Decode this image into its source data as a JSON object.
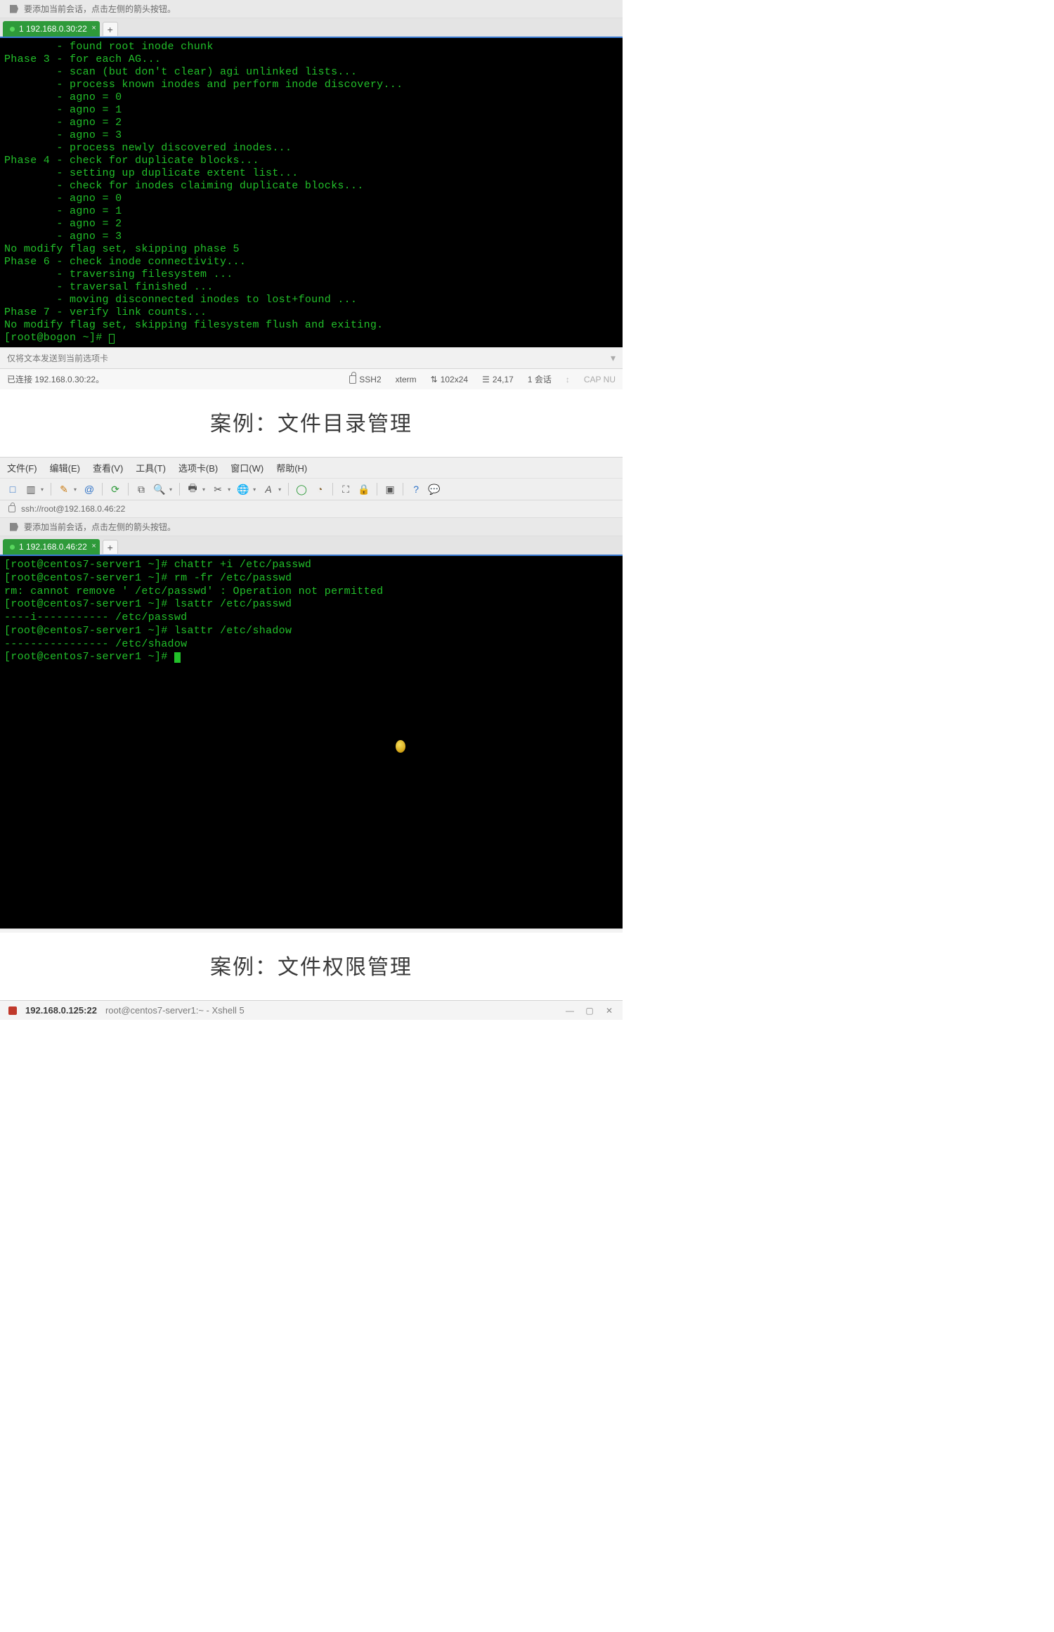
{
  "hint1": "要添加当前会话，点击左侧的箭头按钮。",
  "tab1": {
    "label": "1 192.168.0.30:22"
  },
  "addtab": "+",
  "term1_lines": [
    "        - found root inode chunk",
    "Phase 3 - for each AG...",
    "        - scan (but don't clear) agi unlinked lists...",
    "        - process known inodes and perform inode discovery...",
    "        - agno = 0",
    "        - agno = 1",
    "        - agno = 2",
    "        - agno = 3",
    "        - process newly discovered inodes...",
    "Phase 4 - check for duplicate blocks...",
    "        - setting up duplicate extent list...",
    "        - check for inodes claiming duplicate blocks...",
    "        - agno = 0",
    "        - agno = 1",
    "        - agno = 2",
    "        - agno = 3",
    "No modify flag set, skipping phase 5",
    "Phase 6 - check inode connectivity...",
    "        - traversing filesystem ...",
    "        - traversal finished ...",
    "        - moving disconnected inodes to lost+found ...",
    "Phase 7 - verify link counts...",
    "No modify flag set, skipping filesystem flush and exiting."
  ],
  "term1_prompt": "[root@bogon ~]# ",
  "sendbar_text": "仅将文本发送到当前选项卡",
  "status1": {
    "left": "已连接 192.168.0.30:22。",
    "ssh": "SSH2",
    "term": "xterm",
    "size": "102x24",
    "pos": "24,17",
    "sess": "1 会话",
    "caps": "CAP  NU"
  },
  "heading1": "案例：文件目录管理",
  "menubar": {
    "file": "文件(F)",
    "edit": "编辑(E)",
    "view": "查看(V)",
    "tools": "工具(T)",
    "tabs": "选项卡(B)",
    "window": "窗口(W)",
    "help": "帮助(H)"
  },
  "addrbar": "ssh://root@192.168.0.46:22",
  "hint2": "要添加当前会话，点击左侧的箭头按钮。",
  "tab2": {
    "label": "1 192.168.0.46:22"
  },
  "term2_lines": [
    "[root@centos7-server1 ~]# chattr +i /etc/passwd",
    "[root@centos7-server1 ~]# rm -fr /etc/passwd",
    "rm: cannot remove ' /etc/passwd' : Operation not permitted",
    "[root@centos7-server1 ~]# lsattr /etc/passwd",
    "----i----------- /etc/passwd",
    "[root@centos7-server1 ~]# lsattr /etc/shadow",
    "---------------- /etc/shadow",
    "[root@centos7-server1 ~]# "
  ],
  "heading2": "案例：文件权限管理",
  "title3": {
    "host": "192.168.0.125:22",
    "rest": "root@centos7-server1:~ - Xshell 5"
  },
  "icons": {
    "sizeprefix": "⇅",
    "posprefix": "☰",
    "new": "□",
    "open": "▥",
    "save": "▦",
    "pencil": "✎",
    "at": "@",
    "refresh": "⟳",
    "copy": "⧉",
    "search": "🔍",
    "print": "🖶",
    "clip": "✂",
    "globe": "🌐",
    "font": "A",
    "palette": "◯",
    "paint": "◔",
    "full": "⛶",
    "lock2": "🔒",
    "dash": "▣",
    "help": "?",
    "chat": "💬",
    "min": "—",
    "max": "▢",
    "close": "✕",
    "updn": "↕"
  }
}
